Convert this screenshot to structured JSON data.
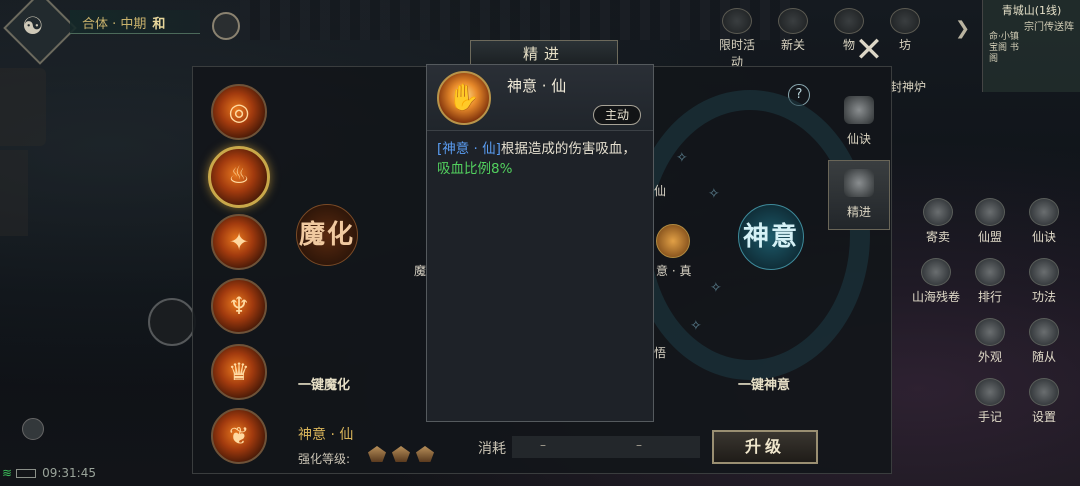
{
  "status": {
    "realm": "合体 · 中期",
    "peace_mode": "和",
    "time": "09:31:45"
  },
  "map": {
    "city": "青城山(1线)",
    "teleport": "宗门传送阵",
    "xiao": "命·小镇 宝阁 书阁"
  },
  "top_bar": [
    {
      "label": "限时活动",
      "icon": "event-icon"
    },
    {
      "label": "新关",
      "icon": "gate-icon"
    },
    {
      "label": "物",
      "icon": "item-icon"
    },
    {
      "label": "坊",
      "icon": "market-icon"
    }
  ],
  "fengshen_label": "封神炉",
  "panel": {
    "title": "精进",
    "left_orb": "魔化",
    "right_orb": "神意",
    "left_node": "魔",
    "node_xian": "仙",
    "node_zhen": "意 · 真",
    "node_wu": "悟",
    "one_click_left": "一键魔化",
    "one_click_right": "一键神意",
    "help": "?",
    "selected_name": "神意 · 仙",
    "level_label": "强化等级:",
    "level_marks": 3,
    "cost_label": "消耗",
    "cost_a": "–",
    "cost_b": "–",
    "upgrade": "升级"
  },
  "skills": [
    {
      "name": "skill-1",
      "active": false
    },
    {
      "name": "skill-2",
      "active": true
    },
    {
      "name": "skill-3",
      "active": false
    },
    {
      "name": "skill-4",
      "active": false
    },
    {
      "name": "skill-5",
      "active": false
    },
    {
      "name": "skill-6",
      "active": false
    }
  ],
  "side_tabs": [
    {
      "label": "仙诀",
      "active": false
    },
    {
      "label": "精进",
      "active": true
    }
  ],
  "right_grid": [
    {
      "label": "寄卖"
    },
    {
      "label": "仙盟"
    },
    {
      "label": "仙诀"
    },
    {
      "label": "山海残卷"
    },
    {
      "label": "排行"
    },
    {
      "label": "功法"
    },
    {
      "label": "外观"
    },
    {
      "label": "随从"
    },
    {
      "label": "手记"
    },
    {
      "label": "设置"
    }
  ],
  "tooltip": {
    "name": "神意 · 仙",
    "tag": "主动",
    "desc_ref": "[神意 · 仙]",
    "desc_main": "根据造成的伤害吸血，",
    "desc_hl": "吸血比例8%"
  },
  "colors": {
    "accent_gold": "#d8b45a",
    "skill_ref_blue": "#5a9cf0",
    "highlight_green": "#52d05e"
  }
}
